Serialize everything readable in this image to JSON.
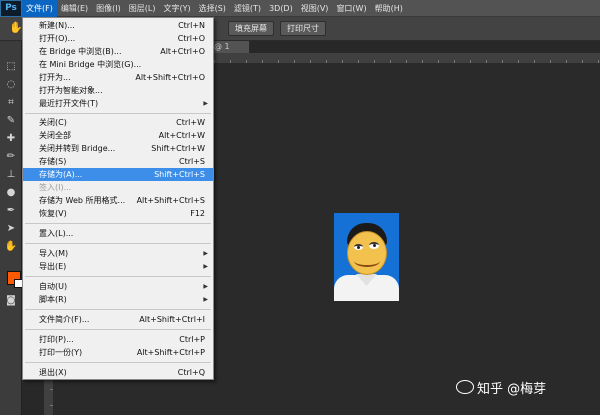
{
  "app": {
    "logo": "Ps"
  },
  "menubar": [
    {
      "label": "文件(F)",
      "active": true
    },
    {
      "label": "编辑(E)"
    },
    {
      "label": "图像(I)"
    },
    {
      "label": "图层(L)"
    },
    {
      "label": "文字(Y)"
    },
    {
      "label": "选择(S)"
    },
    {
      "label": "滤镜(T)"
    },
    {
      "label": "3D(D)"
    },
    {
      "label": "视图(V)"
    },
    {
      "label": "窗口(W)"
    },
    {
      "label": "帮助(H)"
    }
  ],
  "options": {
    "fill_screen": "填充屏幕",
    "print_size": "打印尺寸"
  },
  "document": {
    "tab_label": "@ 1"
  },
  "file_menu": [
    {
      "label": "新建(N)...",
      "shortcut": "Ctrl+N"
    },
    {
      "label": "打开(O)...",
      "shortcut": "Ctrl+O"
    },
    {
      "label": "在 Bridge 中浏览(B)...",
      "shortcut": "Alt+Ctrl+O"
    },
    {
      "label": "在 Mini Bridge 中浏览(G)...",
      "shortcut": ""
    },
    {
      "label": "打开为...",
      "shortcut": "Alt+Shift+Ctrl+O"
    },
    {
      "label": "打开为智能对象...",
      "shortcut": ""
    },
    {
      "label": "最近打开文件(T)",
      "shortcut": "",
      "submenu": true
    },
    {
      "label": "关闭(C)",
      "shortcut": "Ctrl+W"
    },
    {
      "label": "关闭全部",
      "shortcut": "Alt+Ctrl+W"
    },
    {
      "label": "关闭并转到 Bridge...",
      "shortcut": "Shift+Ctrl+W"
    },
    {
      "label": "存储(S)",
      "shortcut": "Ctrl+S"
    },
    {
      "label": "存储为(A)...",
      "shortcut": "Shift+Ctrl+S",
      "highlighted": true
    },
    {
      "label": "签入(I)...",
      "shortcut": "",
      "disabled": true
    },
    {
      "label": "存储为 Web 所用格式...",
      "shortcut": "Alt+Shift+Ctrl+S"
    },
    {
      "label": "恢复(V)",
      "shortcut": "F12"
    },
    {
      "label": "置入(L)...",
      "shortcut": ""
    },
    {
      "label": "导入(M)",
      "shortcut": "",
      "submenu": true
    },
    {
      "label": "导出(E)",
      "shortcut": "",
      "submenu": true
    },
    {
      "label": "自动(U)",
      "shortcut": "",
      "submenu": true
    },
    {
      "label": "脚本(R)",
      "shortcut": "",
      "submenu": true
    },
    {
      "label": "文件简介(F)...",
      "shortcut": "Alt+Shift+Ctrl+I"
    },
    {
      "label": "打印(P)...",
      "shortcut": "Ctrl+P"
    },
    {
      "label": "打印一份(Y)",
      "shortcut": "Alt+Shift+Ctrl+P"
    },
    {
      "label": "退出(X)",
      "shortcut": "Ctrl+Q"
    }
  ],
  "colors": {
    "foreground": "#ff5a00",
    "background": "#ffffff",
    "highlight": "#3d8ee9"
  },
  "watermark": "知乎 @梅芽"
}
